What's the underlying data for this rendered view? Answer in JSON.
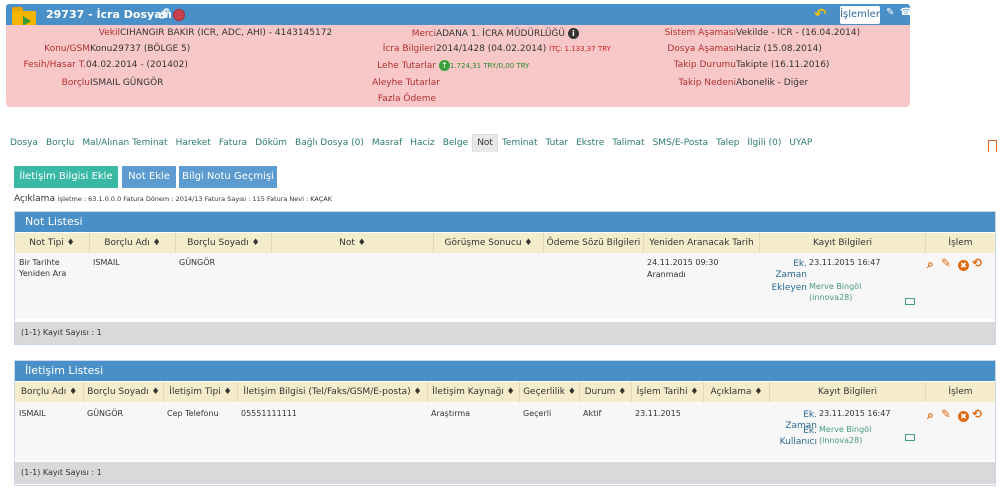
{
  "header": {
    "title": "29737 - İcra Dosyası",
    "islemler_label": "İşlemler",
    "left": [
      {
        "label": "Vekil",
        "value": "CIHANGIR BAKIR (ICR, ADC, AHI) - 4143145172"
      },
      {
        "label": "Konu/GSM",
        "value": "Konu29737 (BÖLGE 5)"
      },
      {
        "label": "Fesih/Hasar T.",
        "value": "04.02.2014 - (201402)"
      },
      {
        "label": "Borçlu",
        "value": "ISMAIL GÜNGÖR"
      }
    ],
    "middle": [
      {
        "label": "Merci",
        "value": "ADANA 1. İCRA MÜDÜRLÜĞÜ"
      },
      {
        "label": "İcra Bilgileri",
        "value": "2014/1428 (04.02.2014)",
        "extra": "İTÇ: 1.133,37 TRY"
      },
      {
        "label": "Lehe Tutarlar",
        "value": "1.724,31 TRY",
        "value2": "/0,00 TRY"
      },
      {
        "label": "Aleyhe Tutarlar",
        "value": ""
      },
      {
        "label": "Fazla Ödeme",
        "value": ""
      }
    ],
    "right": [
      {
        "label": "Sistem Aşaması",
        "value": "Vekilde - ICR - (16.04.2014)"
      },
      {
        "label": "Dosya Aşaması",
        "value": "Haciz (15.08.2014)"
      },
      {
        "label": "Takip Durumu",
        "value": "Takipte (16.11.2016)"
      },
      {
        "label": "Takip Nedeni",
        "value": "Abonelik - Diğer"
      }
    ]
  },
  "tabs": [
    "Dosya",
    "Borçlu",
    "Mal/Alınan Teminat",
    "Hareket",
    "Fatura",
    "Döküm",
    "Bağlı Dosya (0)",
    "Masraf",
    "Haciz",
    "Belge",
    "Not",
    "Teminat",
    "Tutar",
    "Ekstre",
    "Talimat",
    "SMS/E-Posta",
    "Talep",
    "İlgili (0)",
    "UYAP"
  ],
  "active_tab": "Not",
  "buttons": {
    "iletisim_ekle": "İletişim Bilgisi Ekle",
    "not_ekle": "Not Ekle",
    "bilgi_notu": "Bilgi Notu Geçmişi"
  },
  "aciklama": {
    "label": "Açıklama",
    "text": "İşletme : 63.1.0.0.0 Fatura Dönem : 2014/13 Fatura Sayısı : 115 Fatura Nevi : KAÇAK"
  },
  "not_listesi": {
    "title": "Not Listesi",
    "columns": [
      "Not Tipi ♦",
      "Borçlu Adı ♦",
      "Borçlu Soyadı ♦",
      "Not ♦",
      "Görüşme Sonucu ♦",
      "Ödeme Sözü Bilgileri",
      "Yeniden Aranacak Tarih",
      "Kayıt Bilgileri",
      "İşlem"
    ],
    "row": {
      "not_tipi": "Bir Tarihte Yeniden Ara",
      "borclu_adi": "ISMAIL",
      "borclu_soyadi": "GÜNGÖR",
      "yeniden_tarih": "24.11.2015 09:30",
      "yeniden_durum": "Aranmadı",
      "kayit_label1": "Ek. Zaman",
      "kayit_value1": "23.11.2015 16:47",
      "kayit_label2": "Ekleyen",
      "kayit_user": "Merve Bingöl (innova28)"
    },
    "footer": "(1-1) Kayıt Sayısı : 1"
  },
  "iletisim_listesi": {
    "title": "İletişim Listesi",
    "columns": [
      "Borçlu Adı ♦",
      "Borçlu Soyadı ♦",
      "İletişim Tipi ♦",
      "İletişim Bilgisi (Tel/Faks/GSM/E-posta) ♦",
      "İletişim Kaynağı ♦",
      "Geçerlilik ♦",
      "Durum ♦",
      "İşlem Tarihi ♦",
      "Açıklama ♦",
      "Kayıt Bilgileri",
      "İşlem"
    ],
    "row": {
      "borclu_adi": "ISMAIL",
      "borclu_soyadi": "GÜNGÖR",
      "iletisim_tipi": "Cep Telefonu",
      "iletisim_bilgisi": "05551111111",
      "kaynak": "Araştırma",
      "gecerlilik": "Geçerli",
      "durum": "Aktif",
      "islem_tarihi": "23.11.2015",
      "kayit_label1": "Ek. Zaman",
      "kayit_value1": "23.11.2015 16:47",
      "kayit_label2": "Ek. Kullanıcı",
      "kayit_user": "Merve Bingöl (innova28)"
    },
    "footer": "(1-1) Kayıt Sayısı : 1"
  }
}
